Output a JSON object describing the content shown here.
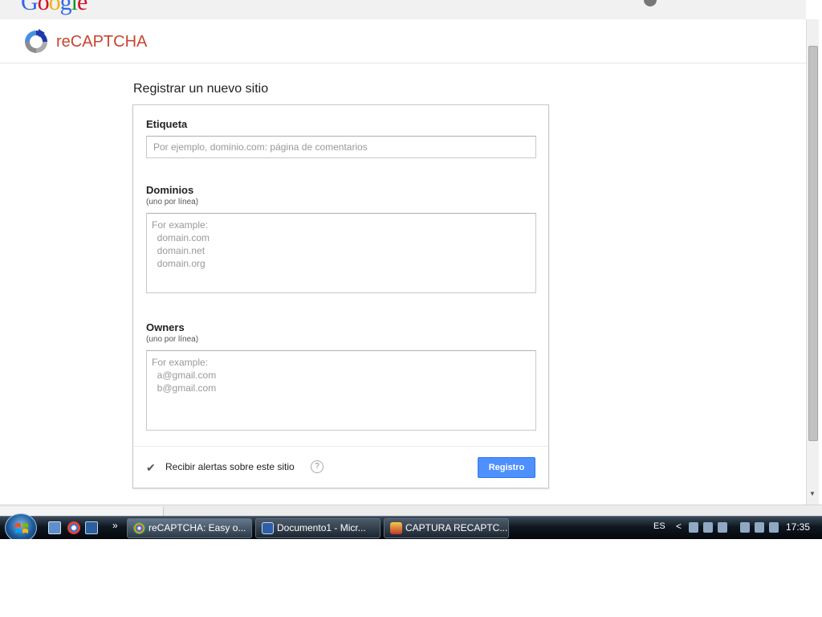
{
  "google_strip": {
    "logo_letters": [
      "G",
      "o",
      "o",
      "g",
      "l",
      "e"
    ],
    "logo_colors": [
      "#3369e8",
      "#d50f25",
      "#eeb211",
      "#3369e8",
      "#009925",
      "#d50f25"
    ]
  },
  "header": {
    "brand": "reCAPTCHA",
    "brand_color": "#c9442f"
  },
  "page": {
    "title": "Registrar un nuevo sitio"
  },
  "form": {
    "label_field": {
      "label": "Etiqueta",
      "value": "",
      "placeholder": "Por ejemplo, dominio.com: página de comentarios"
    },
    "domains_field": {
      "label": "Dominios",
      "hint": "(uno por línea)",
      "value": "",
      "placeholder": "For example:\n  domain.com\n  domain.net\n  domain.org"
    },
    "owners_field": {
      "label": "Owners",
      "hint": "(uno por línea)",
      "value": "",
      "placeholder": "For example:\n  a@gmail.com\n  b@gmail.com"
    },
    "alerts": {
      "checked": true,
      "label": "Recibir alertas sobre este sitio",
      "help_glyph": "?"
    },
    "submit_label": "Registro",
    "accent_color": "#4d90fe"
  },
  "taskbar": {
    "overflow_glyph": "»",
    "windows": [
      {
        "title": "reCAPTCHA: Easy o...",
        "icon": "chrome-icon",
        "active": true
      },
      {
        "title": "Documento1 - Micr...",
        "icon": "word-icon",
        "active": false
      },
      {
        "title": "CAPTURA RECAPTC...",
        "icon": "paint-icon",
        "active": false
      }
    ],
    "tray": {
      "language": "ES",
      "arrow_glyph": "<",
      "clock": "17:35"
    }
  }
}
